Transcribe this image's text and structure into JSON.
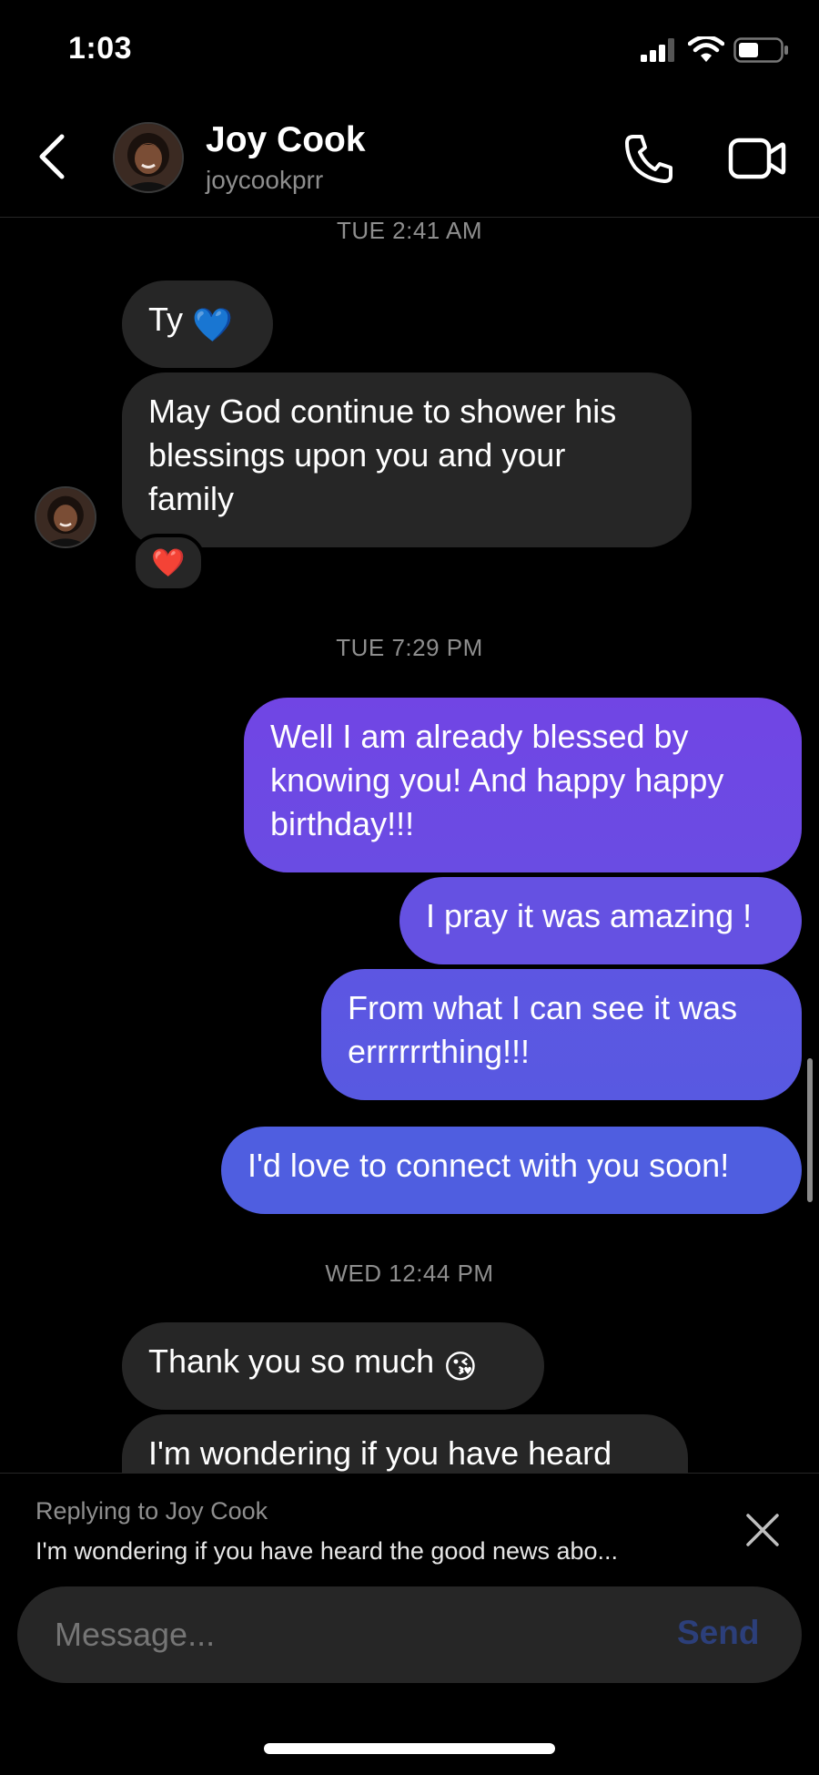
{
  "status_bar": {
    "time": "1:03"
  },
  "header": {
    "contact_name": "Joy Cook",
    "contact_handle": "joycookprr",
    "icons": {
      "back": "chevron-left-icon",
      "call": "phone-icon",
      "video": "video-camera-icon"
    }
  },
  "messages": [
    {
      "timestamp": "TUE 2:41 AM"
    },
    {
      "from": "them",
      "text": "Ty",
      "emoji": "💙"
    },
    {
      "from": "them",
      "lines": [
        "May God continue to shower his",
        "blessings upon you and your",
        "family"
      ],
      "reaction": "❤️"
    },
    {
      "timestamp": "TUE 7:29 PM"
    },
    {
      "from": "me",
      "lines": [
        "Well I am already blessed by",
        "knowing you! And happy happy",
        "birthday!!!"
      ]
    },
    {
      "from": "me",
      "text": "I pray it was amazing !"
    },
    {
      "from": "me",
      "lines": [
        "From what I can see it was",
        "errrrrrthing!!!"
      ]
    },
    {
      "from": "me",
      "text": "I'd love to connect with you soon!"
    },
    {
      "timestamp": "WED 12:44 PM"
    },
    {
      "from": "them",
      "text": "Thank you so much",
      "emoji": "😘"
    },
    {
      "from": "them",
      "text": "I'm wondering if you have heard"
    }
  ],
  "reply": {
    "label": "Replying to Joy Cook",
    "preview": "I'm wondering if you have heard the good news abo..."
  },
  "composer": {
    "placeholder": "Message...",
    "send_label": "Send"
  },
  "colors": {
    "background": "#000000",
    "incoming_bubble": "#262626",
    "outgoing_gradient_top": "#7145e4",
    "outgoing_gradient_bottom": "#4f5ee0",
    "send_disabled": "#2c3f7a"
  }
}
